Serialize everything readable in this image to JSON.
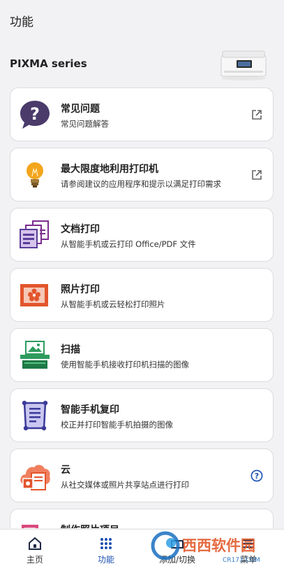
{
  "header": {
    "title": "功能"
  },
  "printer": {
    "name": "PIXMA series"
  },
  "features": [
    {
      "title": "常见问题",
      "desc": "常见问题解答",
      "icon": "question-bubble-icon",
      "trail": "external-link-icon"
    },
    {
      "title": "最大限度地利用打印机",
      "desc": "请参阅建议的应用程序和提示以满足打印需求",
      "icon": "lightbulb-icon",
      "trail": "external-link-icon"
    },
    {
      "title": "文档打印",
      "desc": "从智能手机或云打印 Office/PDF 文件",
      "icon": "document-print-icon",
      "trail": ""
    },
    {
      "title": "照片打印",
      "desc": "从智能手机或云轻松打印照片",
      "icon": "photo-print-icon",
      "trail": ""
    },
    {
      "title": "扫描",
      "desc": "使用智能手机接收打印机扫描的图像",
      "icon": "scan-icon",
      "trail": ""
    },
    {
      "title": "智能手机复印",
      "desc": "校正并打印智能手机拍摄的图像",
      "icon": "smartphone-copy-icon",
      "trail": ""
    },
    {
      "title": "云",
      "desc": "从社交媒体或照片共享站点进行打印",
      "icon": "cloud-icon",
      "trail": "help-icon"
    },
    {
      "title": "制作照片项目",
      "desc": "",
      "icon": "photo-project-icon",
      "trail": ""
    }
  ],
  "nav": [
    {
      "label": "主页",
      "icon": "home-icon"
    },
    {
      "label": "功能",
      "icon": "grid-icon",
      "active": true
    },
    {
      "label": "添加/切换",
      "icon": "add-switch-icon"
    },
    {
      "label": "菜单",
      "icon": "menu-icon"
    }
  ],
  "watermark": {
    "text": "西西软件园",
    "sub": "CR173.COM"
  },
  "colors": {
    "accent": "#1a4fb3",
    "purple": "#6a3d9a",
    "orange": "#e2552c",
    "green": "#2e9b5d"
  }
}
